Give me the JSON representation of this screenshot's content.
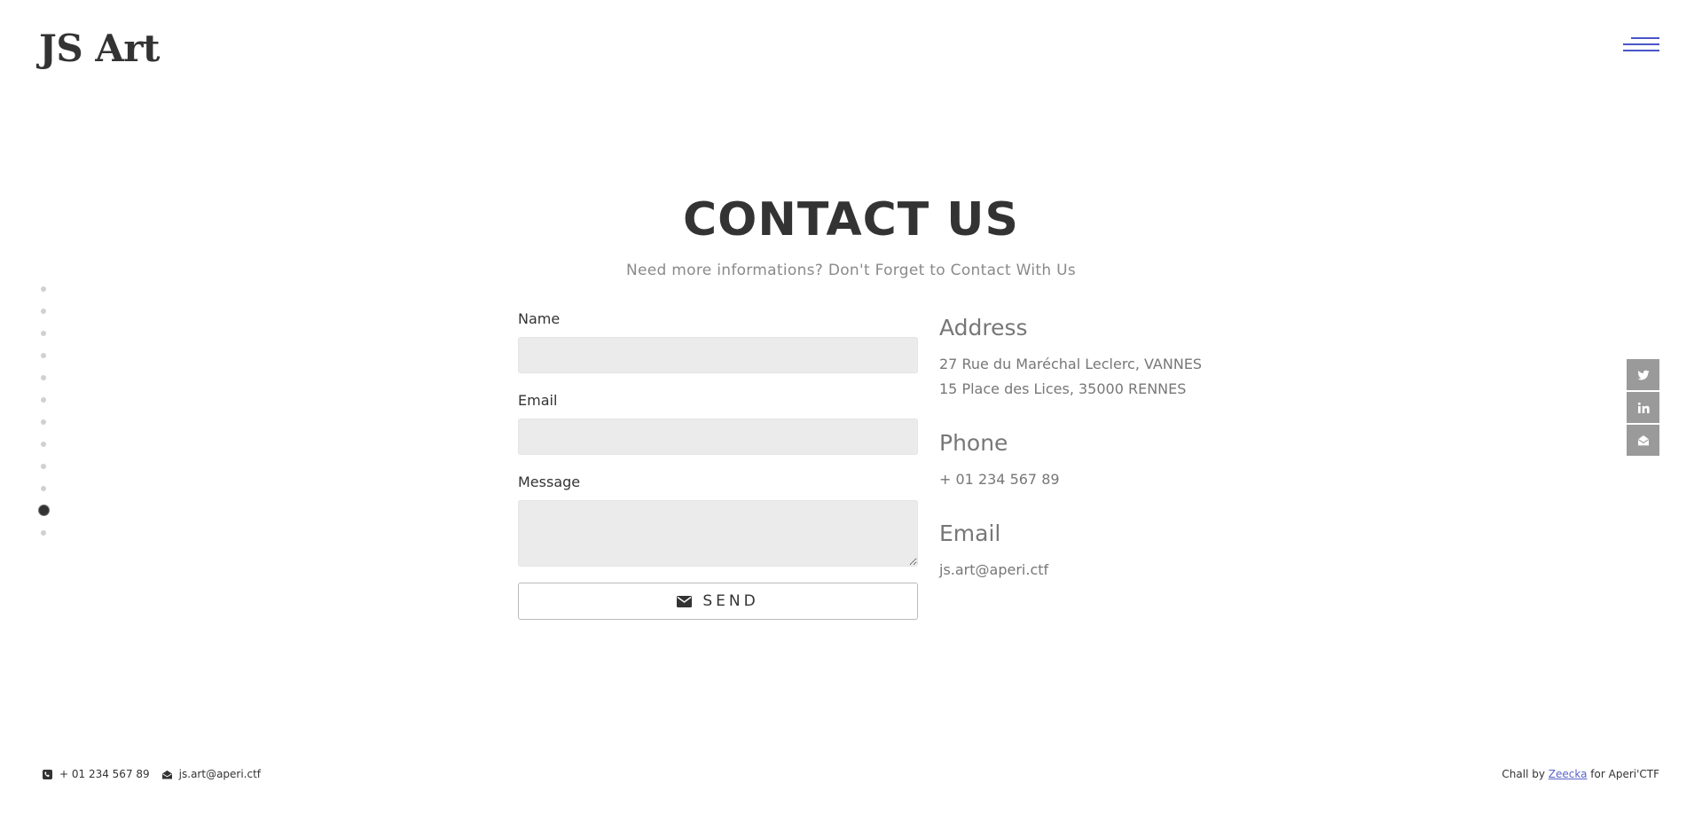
{
  "header": {
    "logo": "JS Art",
    "menu_icon": "hamburger-icon",
    "accent_color": "#4a55c8"
  },
  "side_nav": {
    "dot_count": 12,
    "active_index": 10
  },
  "section": {
    "title": "CONTACT US",
    "subtitle": "Need more informations? Don't Forget to Contact With Us"
  },
  "form": {
    "name_label": "Name",
    "name_value": "",
    "email_label": "Email",
    "email_value": "",
    "message_label": "Message",
    "message_value": "",
    "send_label": "SEND",
    "send_icon": "envelope-icon"
  },
  "info": {
    "address_heading": "Address",
    "address_line1": "27 Rue du Maréchal Leclerc, VANNES",
    "address_line2": "15 Place des Lices, 35000 RENNES",
    "phone_heading": "Phone",
    "phone": "+ 01 234 567 89",
    "email_heading": "Email",
    "email": "js.art@aperi.ctf"
  },
  "social": {
    "items": [
      "twitter-icon",
      "linkedin-icon",
      "email-icon"
    ],
    "color": "#9a9a9a"
  },
  "footer": {
    "phone": "+ 01 234 567 89",
    "email": "js.art@aperi.ctf",
    "credit_prefix": "Chall by",
    "credit_link": "Zeecka",
    "credit_suffix": "for Aperi'CTF",
    "link_color": "#5a63c9"
  }
}
